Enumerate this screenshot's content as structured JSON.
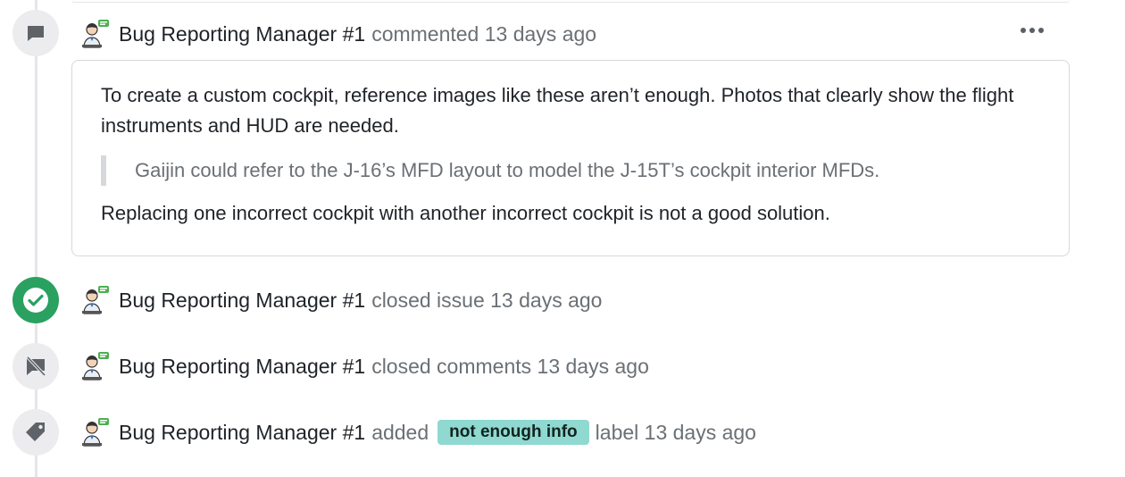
{
  "comment": {
    "author": "Bug Reporting Manager #1",
    "action": "commented 13 days ago",
    "menu_icon": "more-icon",
    "body_line1": "To create a custom cockpit, reference images like these aren’t enough. Photos that clearly show the flight instruments and HUD are needed.",
    "quote": "Gaijin could refer to the J-16’s MFD layout to model the J-15T’s cockpit interior MFDs.",
    "body_line2": "Replacing one incorrect cockpit with another incorrect cockpit is not a good solution."
  },
  "events": [
    {
      "author": "Bug Reporting Manager #1",
      "action": "closed issue 13 days ago",
      "icon": "check-icon",
      "color": "#2aa160"
    },
    {
      "author": "Bug Reporting Manager #1",
      "action": "closed comments 13 days ago",
      "icon": "comment-off-icon"
    },
    {
      "author": "Bug Reporting Manager #1",
      "action_prefix": "added",
      "label": "not enough info",
      "action_suffix": "label 13 days ago",
      "icon": "tag-icon",
      "label_color": "#8fd9d1"
    }
  ]
}
